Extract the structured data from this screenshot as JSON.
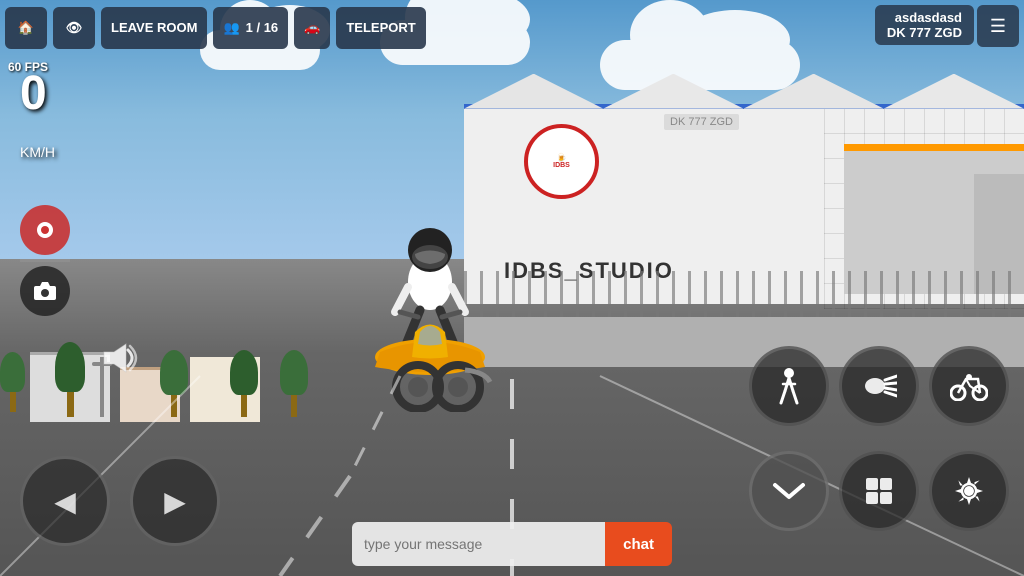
{
  "topBar": {
    "homeIcon": "🏠",
    "eyeIcon": "👁",
    "leaveRoomLabel": "LEAVE ROOM",
    "playersIcon": "👥",
    "playersCount": "1 / 16",
    "vehicleIcon": "🚗",
    "teleportLabel": "TELEPORT"
  },
  "playerInfo": {
    "username": "asdasdasd",
    "plate": "DK 777 ZGD",
    "menuIcon": "☰"
  },
  "hud": {
    "fps": "60 FPS",
    "speed": "0",
    "speedUnit": "KM/H"
  },
  "chat": {
    "inputPlaceholder": "type your message",
    "sendLabel": "chat"
  },
  "scene": {
    "buildingText": "IDBS_STUDIO",
    "playerPlate": "DK 777 ZGD",
    "buildingLogoText": "IDBS"
  },
  "controls": {
    "leftArrow": "◀",
    "rightArrow": "▶",
    "downChevron": "⌄",
    "recordIcon": "record",
    "cameraIcon": "camera",
    "hornIcon": "horn",
    "walkIcon": "🚶",
    "lightsIcon": "💡",
    "bikeIcon": "🏍",
    "gearIcon": "⚙"
  }
}
